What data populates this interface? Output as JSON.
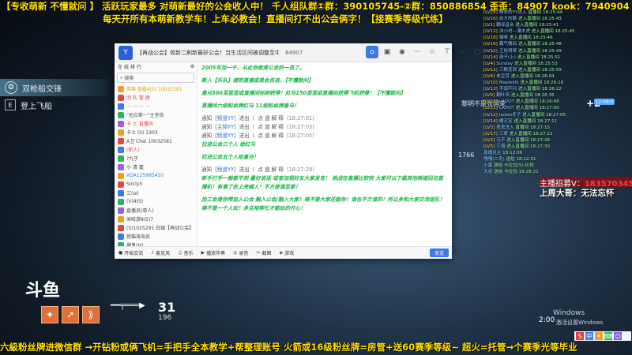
{
  "banner": {
    "line1": "【专收萌新 不懂就问 】 活跃玩家最多 对萌新最好的公会收人中！ 千人组队群①群：390105745-②群：850886854  歪歪：84907  kook：79409042",
    "line2": "每天开所有本萌新教学车！上车必教会！直播间打不出公会俩字！【接赛季等级代练】"
  },
  "game_menu": {
    "items": [
      {
        "label": "双枪船交锋",
        "active": true
      },
      {
        "label": "登上飞船",
        "active": false
      }
    ]
  },
  "chat_window": {
    "title": "【再战公会】收新二刷新最好公会！当生活区间被调整至中等水准……（YY频道）",
    "count": "84907",
    "toolbar_icons": [
      "home-icon",
      "image-icon",
      "gamepad-icon",
      "more-icon",
      "star-icon",
      "pin-icon",
      "minimize-icon",
      "maximize-icon",
      "close-icon"
    ],
    "member_panel": {
      "header": "在  线  排  行",
      "search_placeholder": "搜索",
      "rows": [
        {
          "text": "英雄 圣殿4(S) 10032581",
          "color": "#d9a400"
        },
        {
          "text": "团  队  管  理",
          "color": "#d94c4c"
        },
        {
          "text": "一  一  一  一",
          "color": "#999999"
        },
        {
          "text": "\"无应第一\"主室练",
          "color": "#555555"
        },
        {
          "text": "卡  土  直播间",
          "color": "#d94c4c"
        },
        {
          "text": "卡土 (S)  1303",
          "color": "#444444"
        },
        {
          "text": "A卫  Chai 10032581",
          "color": "#444444"
        },
        {
          "text": "(新人)",
          "color": "#d94c4c"
        },
        {
          "text": "?九子",
          "color": "#444444"
        },
        {
          "text": "小  清  嘉",
          "color": "#444444"
        },
        {
          "text": "XDA125985410",
          "color": "#3f78e8"
        },
        {
          "text": "Sirclyh",
          "color": "#444444"
        },
        {
          "text": "三(w)",
          "color": "#444444"
        },
        {
          "text": "(V)4(S)",
          "color": "#444444"
        },
        {
          "text": "直播员(单人)",
          "color": "#444444"
        },
        {
          "text": "米哈游8(S)7",
          "color": "#444444"
        },
        {
          "text": "(S)1025291 白银【再战公会】",
          "color": "#444444"
        },
        {
          "text": "就猫海海员",
          "color": "#444444"
        },
        {
          "text": "爆鬼(H)",
          "color": "#444444"
        },
        {
          "text": "道天大(W)",
          "color": "#444444"
        },
        {
          "text": "Goldie(v)",
          "color": "#444444"
        },
        {
          "text": "帕奇(V)",
          "color": "#444444"
        }
      ]
    },
    "messages": [
      {
        "type": "hi",
        "text": "2005年加一千，从此你就是公会的一员了。"
      },
      {
        "type": "hi",
        "text": "新人【乐队】请到直播或是会员进、【不懂就问】",
        "red_tail": "【不懂就问】"
      },
      {
        "type": "hi",
        "text": "皇马300至歪歪或直播间标树获得！红马150歪歪或直播间获得飞机获得！【不懂就问】"
      },
      {
        "type": "hi",
        "text": "直播间六级粉丝牌红马 11级粉丝牌皇马！"
      },
      {
        "type": "sys",
        "icon": "通知",
        "user": "[频道YY]",
        "action": "进出（",
        "pos": "点  道  解  释",
        "time": "(18:27:01)"
      },
      {
        "type": "sys",
        "icon": "通知",
        "user": "[主频YY]",
        "action": "进出（",
        "pos": "点  道  解  释",
        "time": "(18:27:03)"
      },
      {
        "type": "sys",
        "icon": "通知",
        "user": "[频道YY]",
        "action": "进出（",
        "pos": "点  道  解  释",
        "time": "(18:27:05)"
      },
      {
        "type": "hi",
        "text": "拉进公会三个人 给红马"
      },
      {
        "type": "hi",
        "text": "拉进公会五个人给皇马！"
      },
      {
        "type": "sys",
        "icon": "通知",
        "user": "[频道YY]",
        "action": "进出（",
        "pos": "点  道  解  释",
        "time": "(18:27:29)"
      },
      {
        "type": "hi",
        "text": "新手打手一般都不到 最好说话 或者加我好友大家发言！  挑战在直播比较快 大家可以下载其他频道回访直播机！有事了在上来喊人！不方便请至家！"
      },
      {
        "type": "hi",
        "text": "加工会是你带加入公会 融入公会/融入大家！萌不是大家还能你！谁也不欠谁的！所以多和大家交流组队！萌不是一个人玩！多互相帮忙才能玩的开心！"
      }
    ],
    "bottom_bar": [
      "开始交流",
      "麦克风",
      "音乐",
      "播放伴奏",
      "录音",
      "截图",
      "游戏",
      "设置"
    ],
    "send_label": "发送"
  },
  "live_chat": {
    "rows": [
      {
        "lv": "LV25",
        "name": "精彩的YY进入",
        "text": "直播间",
        "time": "18:25:44"
      },
      {
        "lv": "LV16",
        "name": "前方的路",
        "text": "进入直播间",
        "time": "18:25:43"
      },
      {
        "lv": "LV1",
        "name": "翻译音会",
        "text": "进入直播间",
        "time": "18:25:41"
      },
      {
        "lv": "LV12",
        "name": "沐小村—薄木虎",
        "text": "进入直播间",
        "time": "18:25:45"
      },
      {
        "lv": "LV18",
        "name": "猫咪",
        "text": "进入直播间",
        "time": "18:25:46"
      },
      {
        "lv": "LV16",
        "name": "霸气情侣",
        "text": "进入直播间",
        "time": "18:25:48"
      },
      {
        "lv": "LV12",
        "name": "王旭哥哥",
        "text": "进入直播间",
        "time": "18:25:49"
      },
      {
        "lv": "LV14",
        "name": "游子(上)",
        "text": "进入直播间",
        "time": "18:25:51"
      },
      {
        "lv": "LV4",
        "name": "Sunday",
        "text": "进入直播间",
        "time": "18:25:53"
      },
      {
        "lv": "LV12",
        "name": "三颗变邪",
        "text": "进入直播间",
        "time": "18:25:59"
      },
      {
        "lv": "LV4",
        "name": "老豆芽",
        "text": "进入直播间",
        "time": "18:26:04"
      },
      {
        "lv": "LV10",
        "name": "Mapleklk",
        "text": "进入直播间",
        "time": "18:26:16"
      },
      {
        "lv": "LV13",
        "name": "不闻不问",
        "text": "进入直播间",
        "time": "18:26:22"
      },
      {
        "lv": "LV9",
        "name": "翻叶风",
        "text": "进入直播间",
        "time": "18:26:35"
      },
      {
        "lv": "LV22",
        "name": "LADOT",
        "text": "进入直播间",
        "time": "18:26:48"
      },
      {
        "lv": "LV11",
        "name": "LADOT",
        "text": "进入直播间",
        "time": "18:27:00"
      },
      {
        "lv": "LV12",
        "name": "ladies冬子",
        "text": "进入直播间",
        "time": "18:27:05"
      },
      {
        "lv": "LV14",
        "name": "暖汉宝",
        "text": "进入直播间",
        "time": "18:27:11"
      },
      {
        "lv": "LV3",
        "name": "墨鬼进入",
        "text": "直播间",
        "time": "18:27:15"
      },
      {
        "lv": "LV17",
        "name": "三哥",
        "text": "进入直播间",
        "time": "18:27:21"
      },
      {
        "lv": "LV2",
        "name": "马不",
        "text": "进入直播间",
        "time": "18:27:26"
      },
      {
        "lv": "LV5",
        "name": "三嗨",
        "text": "进入直播间",
        "time": "18:27:30"
      },
      {
        "lv": "",
        "name": "直播兑主",
        "text": "18:12:06",
        "time": ""
      },
      {
        "lv": "",
        "name": "嘎嘎(二冬)",
        "text": "送给 18:12:51",
        "time": ""
      },
      {
        "lv": "",
        "name": "小蛋",
        "text": "送给 卡拉拉(S):比较",
        "time": ""
      },
      {
        "lv": "",
        "name": "大叔",
        "text": "送给 卡拉拉:18:28:22",
        "time": ""
      },
      {
        "lv": "",
        "name": "爱情",
        "text": "送给 卡拉:18:28:24",
        "time": ""
      }
    ]
  },
  "right_overlay": {
    "line1_prefix": "主播招募V：",
    "line1_value": "1835703459",
    "line2": "上周大哥：无法忘怀"
  },
  "hud": {
    "emblem": "斗鱼",
    "ammo_primary": "31",
    "ammo_reserve": "196"
  },
  "windows": {
    "watermark1": "Windows",
    "watermark2": "激活设置Windows",
    "clock": "2:00"
  },
  "floating": {
    "plus": "+2",
    "badge": "12:09:0",
    "text1": "黎明不是张国荣",
    "text2": "1766"
  }
}
